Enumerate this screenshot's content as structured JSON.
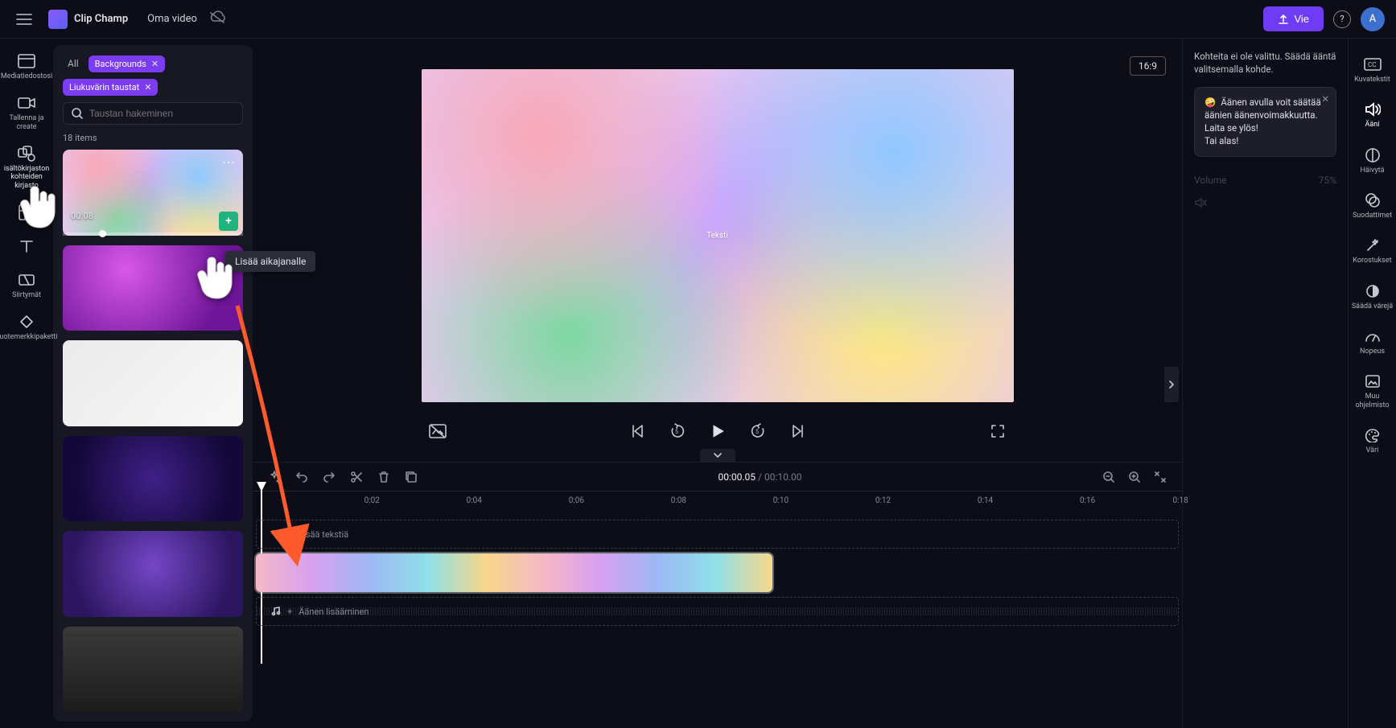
{
  "header": {
    "app_name": "Clip Champ",
    "project_name": "Oma video",
    "export_label": "Vie",
    "avatar_initial": "A"
  },
  "rail": {
    "media": "Mediatiedostosi",
    "record": "Tallenna ja create",
    "library": "isältökirjaston kohteiden kirjasto",
    "templates": "",
    "text": "",
    "transitions": "Siirtymät",
    "brand": "Tuotemerkkipaketti"
  },
  "side_panel": {
    "all_label": "All",
    "chip1": "Backgrounds",
    "chip2": "Liukuvärin taustat",
    "search_placeholder": "Taustan hakeminen",
    "items_count": "18",
    "items_word": "items",
    "thumb1_duration": "00:08",
    "tooltip_add": "Lisää aikajanalle"
  },
  "preview": {
    "text_label": "Teksti",
    "aspect": "16:9"
  },
  "timeline": {
    "current": "00:00.05",
    "total": "00:10.00",
    "ticks": [
      "0:02",
      "0:04",
      "0:06",
      "0:08",
      "0:10",
      "0:12",
      "0:14",
      "0:16",
      "0:18"
    ],
    "add_text": "Lisää tekstiä",
    "add_audio": "Äänen lisääminen"
  },
  "props": {
    "empty_text": "Kohteita ei ole valittu. Säädä ääntä valitsemalla kohde.",
    "tip_line1": "Äänen avulla voit säätää äänien äänenvoimakkuutta.",
    "tip_line2": "Laita se ylös!",
    "tip_line3": "Tai alas!",
    "volume_label": "Volume",
    "volume_value": "75%"
  },
  "right_rail": {
    "captions": "Kuvatekstit",
    "audio": "Ääni",
    "fade": "Häivytä",
    "filters": "Suodattimet",
    "adjust": "Korostukset",
    "colors": "Säädä värejä",
    "speed": "Nopeus",
    "software": "Muu ohjelmisto",
    "color": "Väri"
  }
}
